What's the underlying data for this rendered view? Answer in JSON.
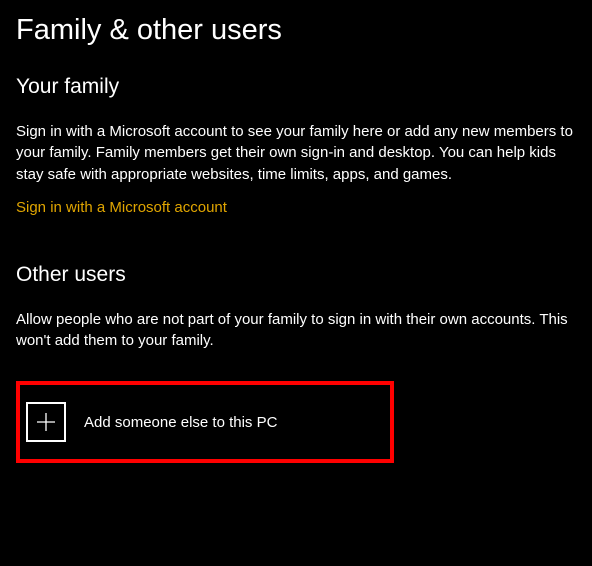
{
  "page": {
    "title": "Family & other users"
  },
  "family": {
    "heading": "Your family",
    "description": "Sign in with a Microsoft account to see your family here or add any new members to your family. Family members get their own sign-in and desktop. You can help kids stay safe with appropriate websites, time limits, apps, and games.",
    "signInLink": "Sign in with a Microsoft account"
  },
  "other": {
    "heading": "Other users",
    "description": "Allow people who are not part of your family to sign in with their own accounts. This won't add them to your family.",
    "addLabel": "Add someone else to this PC"
  }
}
